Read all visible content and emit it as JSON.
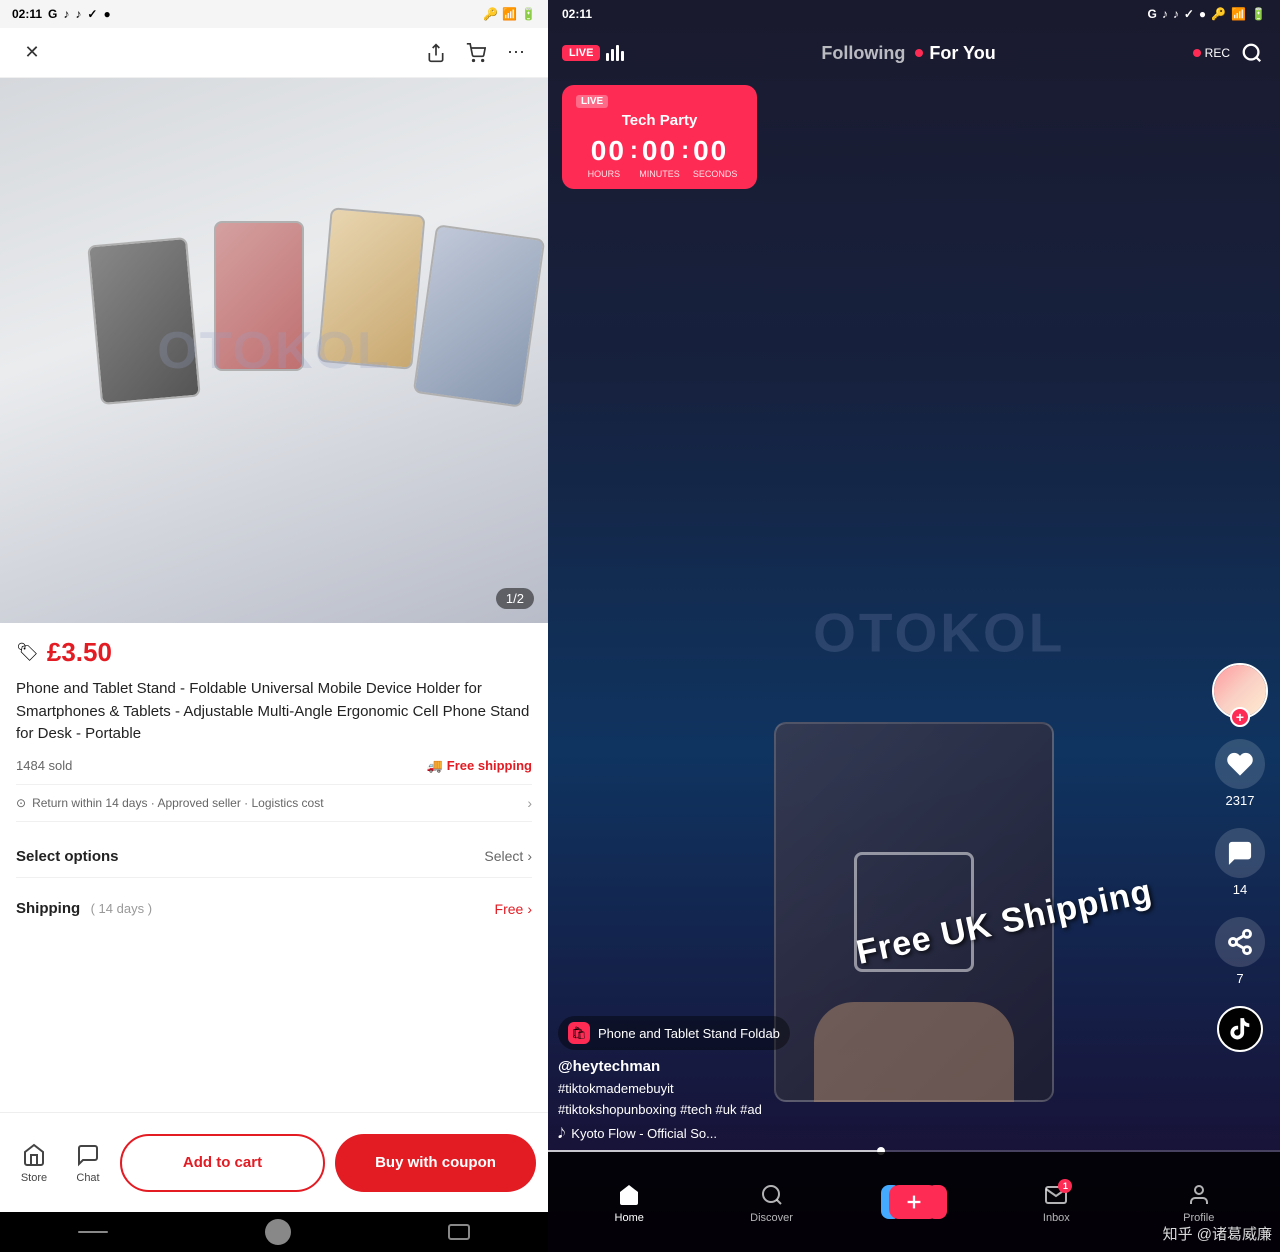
{
  "left": {
    "status_bar": {
      "time": "02:11",
      "icons": [
        "G",
        "TikTok",
        "TikTok",
        "✓",
        "●"
      ]
    },
    "nav": {
      "close_label": "×",
      "share_label": "⬆",
      "cart_label": "🛒",
      "more_label": "⋯"
    },
    "image": {
      "counter": "1/2",
      "watermark": "OTOKOL"
    },
    "product": {
      "currency_icon": "🏷",
      "price": "£3.50",
      "title": "Phone and Tablet Stand - Foldable Universal Mobile Device Holder for Smartphones & Tablets - Adjustable Multi-Angle Ergonomic Cell Phone Stand for Desk - Portable",
      "sold_count": "1484 sold",
      "free_shipping": "Free shipping",
      "return_text": "Return within 14 days · Approved seller · Logistics cost",
      "select_options_label": "Select options",
      "select_action": "Select",
      "shipping_label": "Shipping",
      "shipping_days": "( 14 days )",
      "shipping_value": "Free"
    },
    "bottom_bar": {
      "store_label": "Store",
      "chat_label": "Chat",
      "add_to_cart": "Add to cart",
      "buy_coupon": "Buy with coupon"
    },
    "android_nav": {
      "back": "‹"
    }
  },
  "right": {
    "status_bar": {
      "time": "02:11",
      "icons": [
        "G",
        "TikTok",
        "TikTok",
        "✓",
        "●"
      ]
    },
    "top_nav": {
      "live_badge": "LIVE",
      "live_icon": "⚡",
      "following_label": "Following",
      "for_you_label": "For You",
      "rec_label": "REC",
      "search_label": "🔍"
    },
    "tech_party": {
      "live_badge": "LIVE",
      "title": "Tech Party",
      "hours": "00",
      "minutes": "00",
      "seconds": "00",
      "hours_label": "HOURS",
      "minutes_label": "MINUTES",
      "seconds_label": "SECONDS"
    },
    "video": {
      "watermark": "OTOKOL",
      "shipping_overlay": "Free UK Shipping"
    },
    "actions": {
      "likes": "2317",
      "comments": "14",
      "shares": "7",
      "plus": "+"
    },
    "product_info": {
      "shop_name": "Phone and Tablet Stand  Foldab",
      "creator": "@heytechman",
      "hashtags": "#tiktokmademebuyit\n#tiktokshopunboxing #tech #uk #ad",
      "music": "Kyoto Flow - Official So..."
    },
    "bottom_nav": {
      "home_label": "Home",
      "discover_label": "Discover",
      "inbox_label": "Inbox",
      "inbox_badge": "1",
      "profile_label": "Profile"
    },
    "watermark": "知乎 @诸葛威廉"
  }
}
